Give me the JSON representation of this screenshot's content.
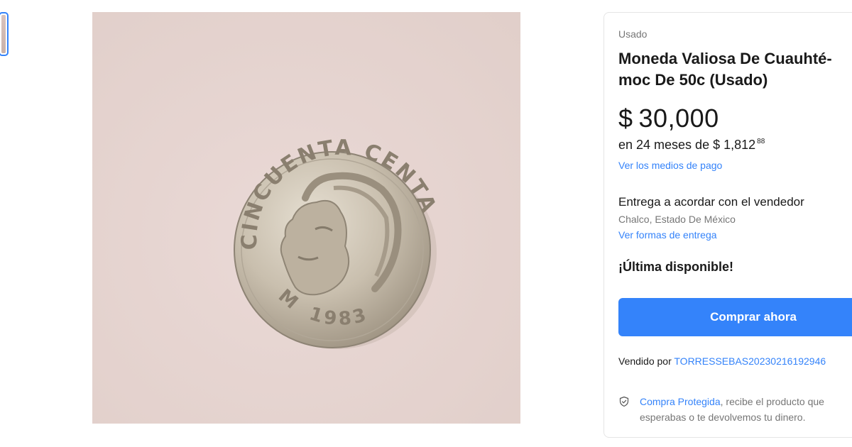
{
  "gallery": {
    "thumbnail_count": 1,
    "main_image_subject": "coin"
  },
  "product": {
    "condition": "Usado",
    "title": "Moneda Valiosa De Cuauhté-moc De 50c (Usado)",
    "title_line1": "Moneda Valiosa De Cuauhté-",
    "title_line2": "moc De 50c (Usado)",
    "price_currency": "$",
    "price_amount": "30,000",
    "installments_text": "en 24 meses de $ 1,812",
    "installments_cents": "88",
    "payment_link": "Ver los medios de pago"
  },
  "shipping": {
    "title": "Entrega a acordar con el vendedor",
    "location": "Chalco, Estado De México",
    "link": "Ver formas de entrega"
  },
  "stock": {
    "label": "¡Última disponible!"
  },
  "actions": {
    "buy_now_label": "Comprar ahora"
  },
  "seller": {
    "prefix": "Vendido por",
    "name": "TORRESSEBAS20230216192946"
  },
  "protection": {
    "link": "Compra Protegida",
    "text": ", recibe el producto que esperabas o te devolvemos tu dinero."
  },
  "coin": {
    "top_inscription": "CINCUENTA CENTAVOS",
    "mint_mark": "M",
    "year": "1983"
  },
  "colors": {
    "accent": "#3483fa",
    "photo_background": "#e6d5d1"
  }
}
